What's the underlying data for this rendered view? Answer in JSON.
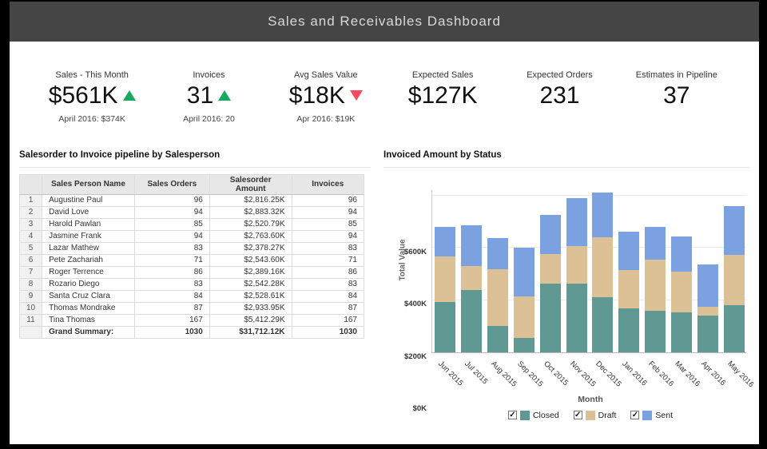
{
  "header": {
    "title": "Sales and Receivables Dashboard"
  },
  "kpis": {
    "items": [
      {
        "label": "Sales - This Month",
        "value": "$561K",
        "trend": "up",
        "subtitle": "April 2016: $374K"
      },
      {
        "label": "Invoices",
        "value": "31",
        "trend": "up",
        "subtitle": "April 2016: 20"
      },
      {
        "label": "Avg Sales Value",
        "value": "$18K",
        "trend": "down",
        "subtitle": "Apr 2016: $19K"
      },
      {
        "label": "Expected Sales",
        "value": "$127K",
        "trend": "none",
        "subtitle": ""
      },
      {
        "label": "Expected Orders",
        "value": "231",
        "trend": "none",
        "subtitle": ""
      },
      {
        "label": "Estimates in Pipeline",
        "value": "37",
        "trend": "none",
        "subtitle": ""
      }
    ],
    "trend_colors": {
      "up": "#18a85e",
      "down": "#fa4b5e"
    }
  },
  "table_panel": {
    "title": "Salesorder to Invoice pipeline by Salesperson",
    "columns": [
      "Sales Person Name",
      "Sales Orders",
      "Salesorder Amount",
      "Invoices"
    ],
    "rows": [
      [
        "Augustine Paul",
        "96",
        "$2,816.25K",
        "96"
      ],
      [
        "David Love",
        "94",
        "$2,883.32K",
        "94"
      ],
      [
        "Harold Pawlan",
        "85",
        "$2,520.79K",
        "85"
      ],
      [
        "Jasmine Frank",
        "94",
        "$2,763.60K",
        "94"
      ],
      [
        "Lazar Mathew",
        "83",
        "$2,378.27K",
        "83"
      ],
      [
        "Pete Zachariah",
        "71",
        "$2,543.60K",
        "71"
      ],
      [
        "Roger Terrence",
        "86",
        "$2,389.16K",
        "86"
      ],
      [
        "Rozario Diego",
        "83",
        "$2,542.28K",
        "83"
      ],
      [
        "Santa Cruz Clara",
        "84",
        "$2,528.61K",
        "84"
      ],
      [
        "Thomas Mondrake",
        "87",
        "$2,933.95K",
        "87"
      ],
      [
        "Tina Thomas",
        "167",
        "$5,412.29K",
        "167"
      ]
    ],
    "summary": [
      "Grand Summary:",
      "1030",
      "$31,712.12K",
      "1030"
    ]
  },
  "chart_panel": {
    "title": "Invoiced Amount by Status"
  },
  "chart_data": {
    "type": "stacked-bar",
    "title": "Invoiced Amount by Status",
    "categories": [
      "Jun 2015",
      "Jul 2015",
      "Aug 2015",
      "Sep 2015",
      "Oct 2015",
      "Nov 2015",
      "Dec 2015",
      "Jan 2016",
      "Feb 2016",
      "Mar 2016",
      "Apr 2016",
      "May 2016"
    ],
    "series": [
      {
        "name": "Closed",
        "color": "#609894",
        "values": [
          192,
          238,
          101,
          55,
          262,
          264,
          212,
          169,
          159,
          153,
          140,
          182
        ]
      },
      {
        "name": "Draft",
        "color": "#dcc096",
        "values": [
          174,
          92,
          216,
          158,
          112,
          144,
          231,
          146,
          197,
          157,
          34,
          192
        ]
      },
      {
        "name": "Sent",
        "color": "#7ba1e1",
        "values": [
          113,
          157,
          119,
          186,
          150,
          185,
          172,
          146,
          127,
          135,
          162,
          188
        ]
      }
    ],
    "values_unit": "$K",
    "totals": [
      479,
      487,
      436,
      399,
      524,
      593,
      615,
      461,
      483,
      445,
      336,
      562
    ],
    "xlabel": "Month",
    "ylabel": "Total Value",
    "ylim": [
      0,
      625
    ],
    "yticks": [
      "$0K",
      "$200K",
      "$400K",
      "$600K"
    ],
    "ytick_values": [
      0,
      200,
      400,
      600
    ],
    "grid": true,
    "legend_position": "bottom",
    "legend_checkboxes_checked": true
  }
}
